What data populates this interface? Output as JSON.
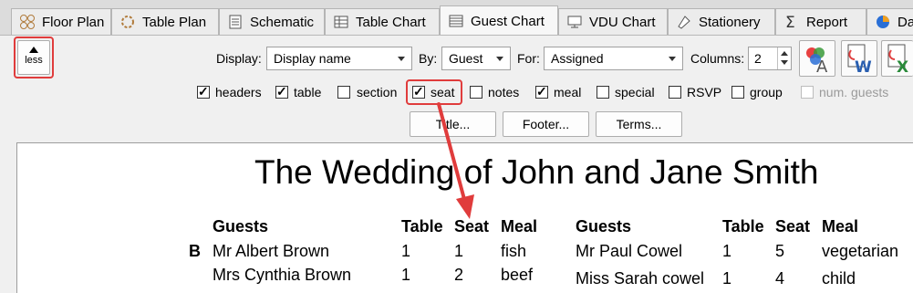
{
  "tabs": [
    {
      "label": "Floor Plan",
      "icon": "floor-plan-icon"
    },
    {
      "label": "Table Plan",
      "icon": "table-plan-icon"
    },
    {
      "label": "Schematic",
      "icon": "schematic-icon"
    },
    {
      "label": "Table Chart",
      "icon": "table-chart-icon"
    },
    {
      "label": "Guest Chart",
      "icon": "guest-chart-icon",
      "active": true
    },
    {
      "label": "VDU Chart",
      "icon": "monitor-icon"
    },
    {
      "label": "Stationery",
      "icon": "stationery-icon"
    },
    {
      "label": "Report",
      "icon": "sigma-icon"
    },
    {
      "label": "Da",
      "icon": "pie-chart-icon"
    }
  ],
  "toolbar": {
    "less_label": "less",
    "display_label": "Display:",
    "display_value": "Display name",
    "by_label": "By:",
    "by_value": "Guest",
    "for_label": "For:",
    "for_value": "Assigned",
    "columns_label": "Columns:",
    "columns_value": "2",
    "buttons": {
      "title": "Title...",
      "footer": "Footer...",
      "terms": "Terms..."
    }
  },
  "checkboxes": [
    {
      "label": "headers",
      "checked": true
    },
    {
      "label": "table",
      "checked": true
    },
    {
      "label": "section",
      "checked": false
    },
    {
      "label": "seat",
      "checked": true
    },
    {
      "label": "notes",
      "checked": false
    },
    {
      "label": "meal",
      "checked": true
    },
    {
      "label": "special",
      "checked": false
    },
    {
      "label": "RSVP",
      "checked": false
    },
    {
      "label": "group",
      "checked": false
    },
    {
      "label": "num. guests",
      "checked": false,
      "disabled": true
    }
  ],
  "chart": {
    "title": "The Wedding of John and Jane Smith",
    "headers": {
      "guests": "Guests",
      "table": "Table",
      "seat": "Seat",
      "meal": "Meal"
    },
    "section_letter": "B",
    "left_rows": [
      {
        "guest": "Mr Albert Brown",
        "table": "1",
        "seat": "1",
        "meal": "fish"
      },
      {
        "guest": "Mrs Cynthia Brown",
        "table": "1",
        "seat": "2",
        "meal": "beef"
      }
    ],
    "right_rows": [
      {
        "guest": "Mr Paul Cowel",
        "table": "1",
        "seat": "5",
        "meal": "vegetarian"
      },
      {
        "guest": "Miss Sarah cowel",
        "table": "1",
        "seat": "4",
        "meal": "child"
      }
    ]
  },
  "colors": {
    "highlight": "#e03c3c"
  }
}
